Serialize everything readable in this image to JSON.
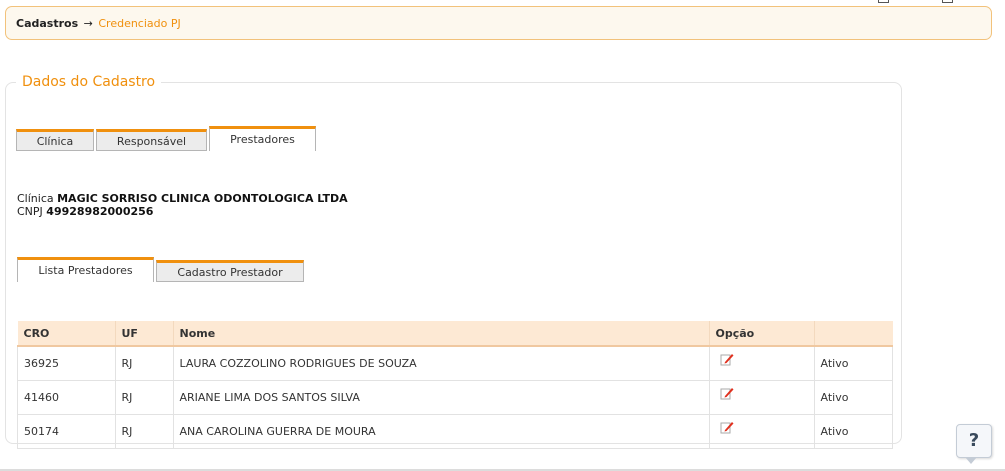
{
  "breadcrumb": {
    "root": "Cadastros",
    "separator": "→",
    "current": "Credenciado PJ"
  },
  "panel": {
    "legend": "Dados do Cadastro"
  },
  "tabs": [
    {
      "label": "Clínica",
      "active": false
    },
    {
      "label": "Responsável",
      "active": false
    },
    {
      "label": "Prestadores",
      "active": true
    }
  ],
  "clinic": {
    "name_label": "Clínica",
    "name": "MAGIC SORRISO CLINICA ODONTOLOGICA LTDA",
    "cnpj_label": "CNPJ",
    "cnpj": "49928982000256"
  },
  "subtabs": [
    {
      "label": "Lista Prestadores",
      "active": true
    },
    {
      "label": "Cadastro Prestador",
      "active": false
    }
  ],
  "table": {
    "headers": [
      "CRO",
      "UF",
      "Nome",
      "Opção",
      ""
    ],
    "rows": [
      {
        "cro": "36925",
        "uf": "RJ",
        "nome": "LAURA COZZOLINO RODRIGUES DE SOUZA",
        "status": "Ativo"
      },
      {
        "cro": "41460",
        "uf": "RJ",
        "nome": "ARIANE LIMA DOS SANTOS SILVA",
        "status": "Ativo"
      },
      {
        "cro": "50174",
        "uf": "RJ",
        "nome": "ANA CAROLINA GUERRA DE MOURA",
        "status": "Ativo"
      }
    ]
  },
  "icons": {
    "edit": "edit-icon",
    "help": "help-icon"
  },
  "help_label": "?",
  "colors": {
    "accent": "#f0900e",
    "header_bg": "#fde9d4",
    "breadcrumb_bg": "#fdf8ee"
  }
}
